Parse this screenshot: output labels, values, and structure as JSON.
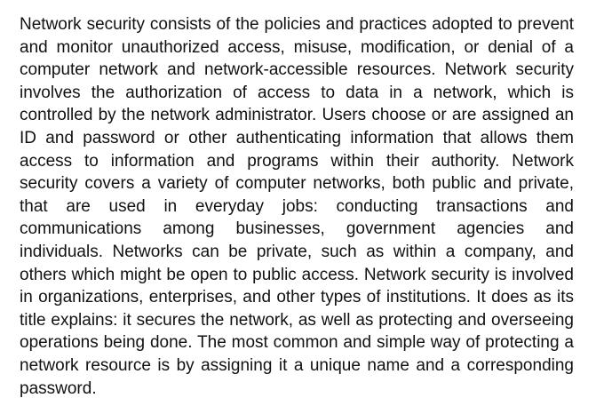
{
  "document": {
    "paragraph": "Network security consists of the policies and practices adopted to prevent and monitor unauthorized access, misuse, modification, or denial of a computer network and network-accessible resources. Network security involves the authorization of access to data in a network, which is controlled by the network administrator. Users choose or are assigned an ID and password or other authenticating information that allows them access to information and programs within their authority. Network security covers a variety of computer networks, both public and private, that are used in everyday jobs: conducting transactions and communications among businesses, government agencies and individuals. Networks can be private, such as within a company, and others which might be open to public access. Network security is involved in organizations, enterprises, and other types of institutions. It does as its title explains: it secures the network, as well as protecting and overseeing operations being done. The most common and simple way of protecting a network resource is by assigning it a unique name and a corresponding password."
  }
}
